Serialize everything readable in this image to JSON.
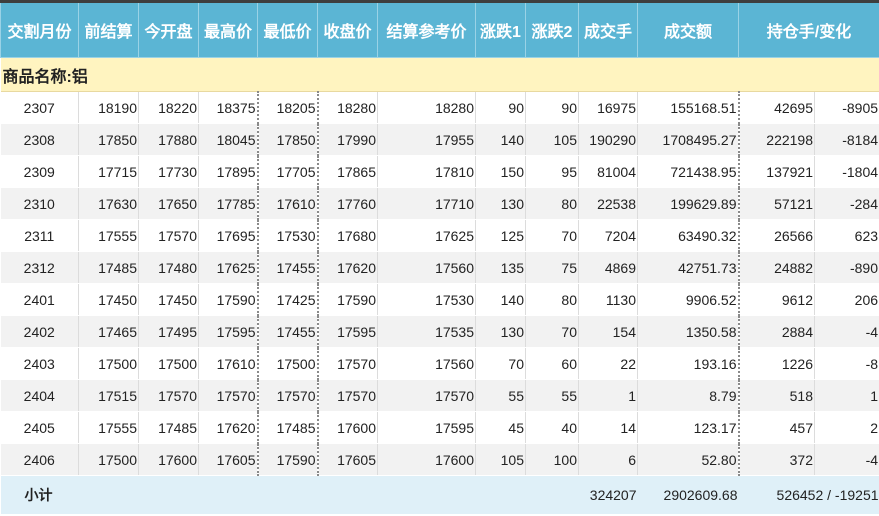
{
  "headers": [
    "交割月份",
    "前结算",
    "今开盘",
    "最高价",
    "最低价",
    "收盘价",
    "结算参考价",
    "涨跌1",
    "涨跌2",
    "成交手",
    "成交额",
    "持仓手/变化"
  ],
  "product_label": "商品名称:铝",
  "rows": [
    [
      "2307",
      "18190",
      "18220",
      "18375",
      "18205",
      "18280",
      "18280",
      "90",
      "90",
      "16975",
      "155168.51",
      "42695",
      "-8905"
    ],
    [
      "2308",
      "17850",
      "17880",
      "18045",
      "17850",
      "17990",
      "17955",
      "140",
      "105",
      "190290",
      "1708495.27",
      "222198",
      "-8184"
    ],
    [
      "2309",
      "17715",
      "17730",
      "17895",
      "17705",
      "17865",
      "17810",
      "150",
      "95",
      "81004",
      "721438.95",
      "137921",
      "-1804"
    ],
    [
      "2310",
      "17630",
      "17650",
      "17785",
      "17610",
      "17760",
      "17710",
      "130",
      "80",
      "22538",
      "199629.89",
      "57121",
      "-284"
    ],
    [
      "2311",
      "17555",
      "17570",
      "17695",
      "17530",
      "17680",
      "17625",
      "125",
      "70",
      "7204",
      "63490.32",
      "26566",
      "623"
    ],
    [
      "2312",
      "17485",
      "17480",
      "17625",
      "17455",
      "17620",
      "17560",
      "135",
      "75",
      "4869",
      "42751.73",
      "24882",
      "-890"
    ],
    [
      "2401",
      "17450",
      "17450",
      "17590",
      "17425",
      "17590",
      "17530",
      "140",
      "80",
      "1130",
      "9906.52",
      "9612",
      "206"
    ],
    [
      "2402",
      "17465",
      "17495",
      "17595",
      "17455",
      "17595",
      "17535",
      "130",
      "70",
      "154",
      "1350.58",
      "2884",
      "-4"
    ],
    [
      "2403",
      "17500",
      "17500",
      "17610",
      "17500",
      "17570",
      "17560",
      "70",
      "60",
      "22",
      "193.16",
      "1226",
      "-8"
    ],
    [
      "2404",
      "17515",
      "17570",
      "17570",
      "17570",
      "17570",
      "17570",
      "55",
      "55",
      "1",
      "8.79",
      "518",
      "1"
    ],
    [
      "2405",
      "17555",
      "17485",
      "17620",
      "17485",
      "17600",
      "17595",
      "45",
      "40",
      "14",
      "123.17",
      "457",
      "2"
    ],
    [
      "2406",
      "17500",
      "17600",
      "17605",
      "17590",
      "17605",
      "17600",
      "105",
      "100",
      "6",
      "52.80",
      "372",
      "-4"
    ]
  ],
  "subtotal": {
    "label": "小计",
    "volume": "324207",
    "turnover": "2902609.68",
    "open_interest": "526452 / -19251"
  },
  "colors": {
    "header_bg": "#5bb5d4",
    "product_row_bg": "#fff4c0",
    "subtotal_bg": "#dff0f8",
    "alt_row_bg": "#f2f2f2"
  }
}
